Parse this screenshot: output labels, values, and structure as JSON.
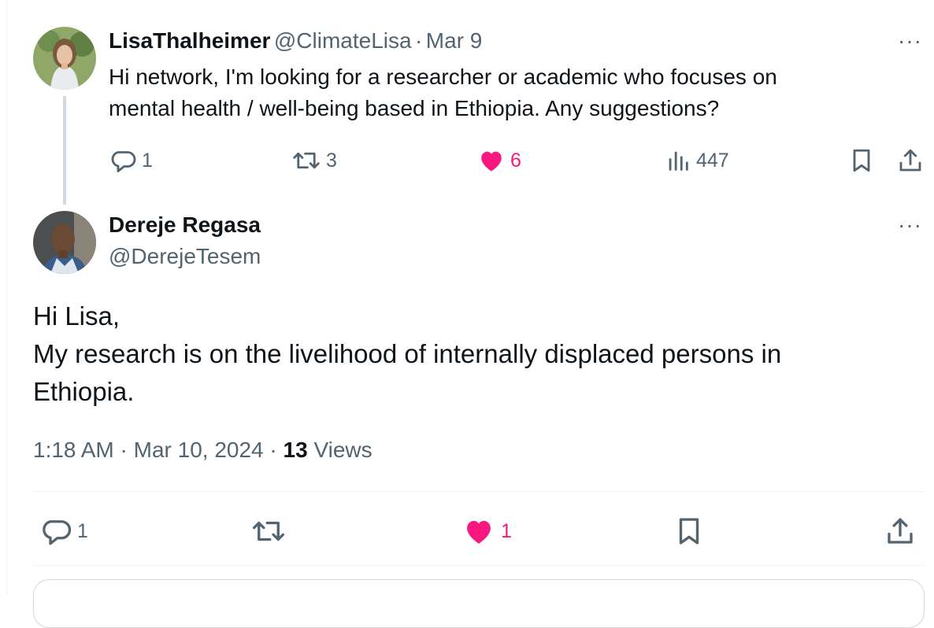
{
  "parent_tweet": {
    "display_name": "LisaThalheimer",
    "handle": "@ClimateLisa",
    "separator": "·",
    "date": "Mar 9",
    "text_line1": "Hi network, I'm looking for a researcher or academic who focuses on",
    "text_line2": "mental health / well-being based in Ethiopia. Any suggestions?",
    "replies": "1",
    "retweets": "3",
    "likes": "6",
    "views": "447",
    "more": "···"
  },
  "main_tweet": {
    "display_name": "Dereje Regasa",
    "handle": "@DerejeTesem",
    "more": "···",
    "text_line1": "Hi Lisa,",
    "text_line2": "My research is on the livelihood of internally displaced persons in",
    "text_line3": "Ethiopia.",
    "time": "1:18 AM",
    "sep1": "·",
    "date": "Mar 10, 2024",
    "sep2": "·",
    "views_count": "13",
    "views_label": "Views",
    "replies": "1",
    "likes": "1"
  },
  "colors": {
    "like_pink": "#f91880",
    "muted": "#536471",
    "border": "#eff3f4"
  }
}
